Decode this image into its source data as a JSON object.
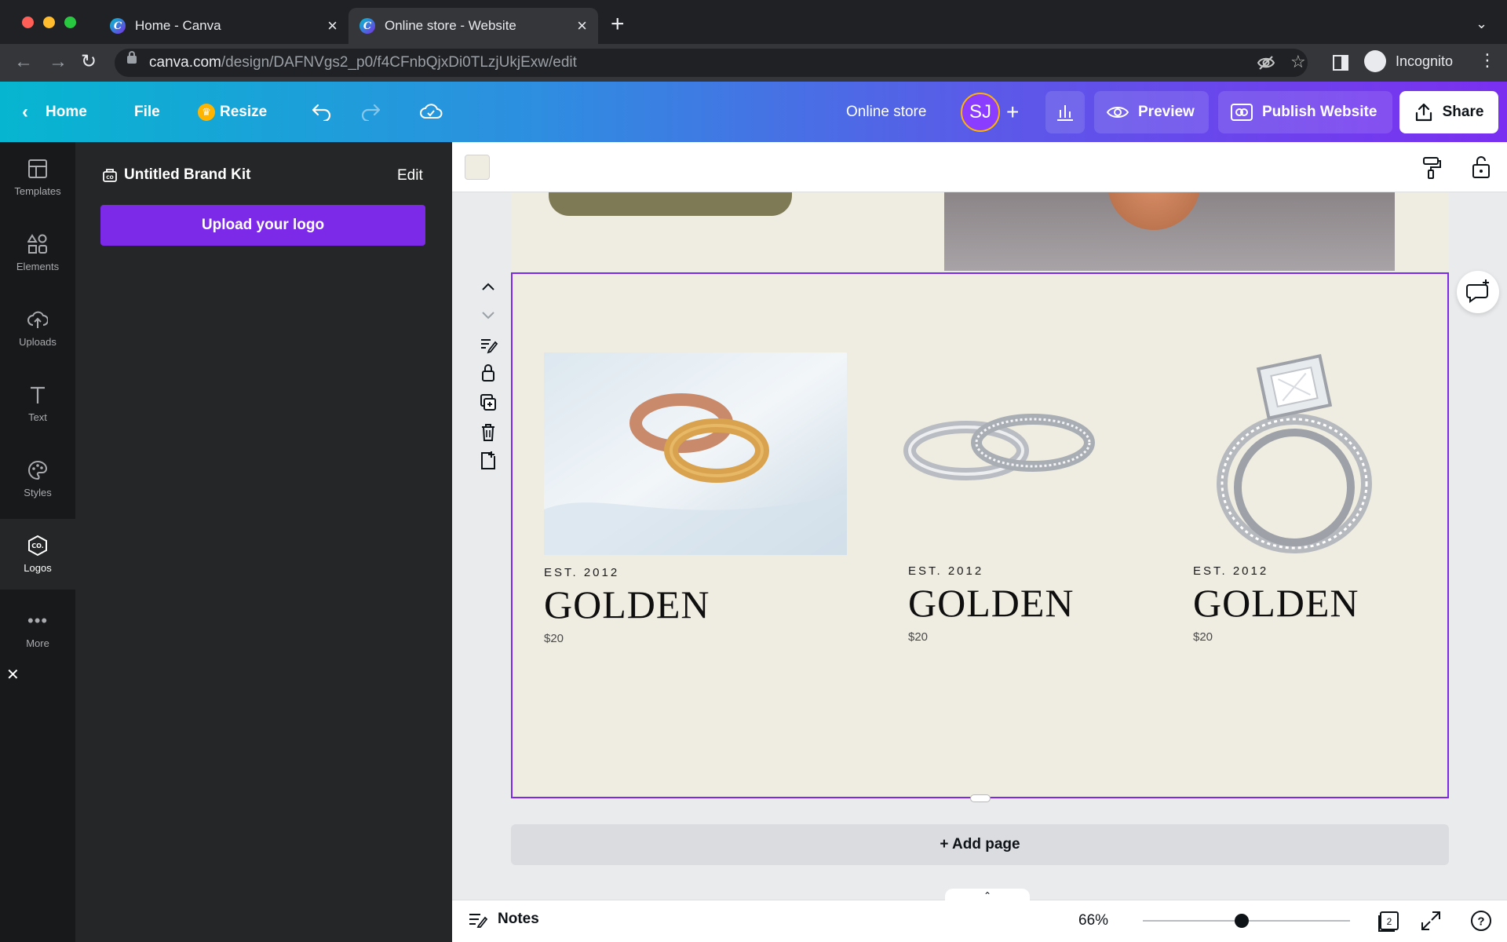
{
  "browser": {
    "tabs": [
      {
        "title": "Home - Canva",
        "active": false
      },
      {
        "title": "Online store - Website",
        "active": true
      }
    ],
    "url_host": "canva.com",
    "url_path": "/design/DAFNVgs2_p0/f4CFnbQjxDi0TLzjUkjExw/edit",
    "profile_label": "Incognito"
  },
  "header": {
    "home_label": "Home",
    "file_label": "File",
    "resize_label": "Resize",
    "design_title": "Online store",
    "avatar_initials": "SJ",
    "preview_label": "Preview",
    "publish_label": "Publish Website",
    "share_label": "Share"
  },
  "rail": {
    "items": [
      {
        "label": "Templates",
        "icon": "templates-icon"
      },
      {
        "label": "Elements",
        "icon": "elements-icon"
      },
      {
        "label": "Uploads",
        "icon": "uploads-icon"
      },
      {
        "label": "Text",
        "icon": "text-icon"
      },
      {
        "label": "Styles",
        "icon": "styles-icon"
      },
      {
        "label": "Logos",
        "icon": "logos-icon",
        "active": true
      },
      {
        "label": "More",
        "icon": "more-icon"
      }
    ]
  },
  "panel": {
    "brand_kit_title": "Untitled Brand Kit",
    "edit_label": "Edit",
    "upload_logo_label": "Upload your logo"
  },
  "canvas": {
    "products": [
      {
        "est": "EST. 2012",
        "name": "GOLDEN",
        "price": "$20",
        "image": "rose-and-gold-rings-photo"
      },
      {
        "est": "EST. 2012",
        "name": "GOLDEN",
        "price": "$20",
        "image": "silver-wedding-bands-photo"
      },
      {
        "est": "EST. 2012",
        "name": "GOLDEN",
        "price": "$20",
        "image": "diamond-ring-photo"
      }
    ],
    "add_page_label": "+ Add page"
  },
  "footer": {
    "notes_label": "Notes",
    "zoom": "66%",
    "page_count": "2"
  },
  "colors": {
    "accent": "#7d2ae8",
    "page_bg": "#efede1"
  }
}
